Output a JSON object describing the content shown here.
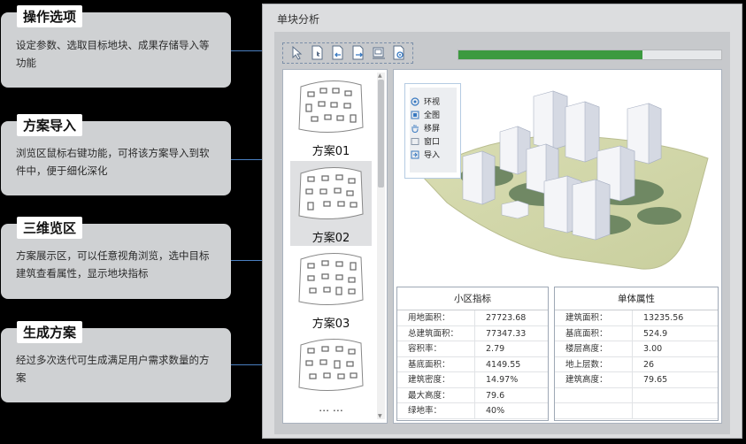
{
  "annotations": [
    {
      "title": "操作选项",
      "desc": "设定参数、选取目标地块、成果存储导入等功能"
    },
    {
      "title": "方案导入",
      "desc": "浏览区鼠标右键功能，可将该方案导入到软件中，便于细化深化"
    },
    {
      "title": "三维览区",
      "desc": "方案展示区，可以任意视角浏览，选中目标建筑查看属性，显示地块指标"
    },
    {
      "title": "生成方案",
      "desc": "经过多次迭代可生成满足用户需求数量的方案"
    }
  ],
  "app": {
    "title": "单块分析"
  },
  "toolbar": {
    "icons": [
      "cursor-icon",
      "select-block-icon",
      "import-icon",
      "export-icon",
      "save-icon",
      "settings-icon"
    ]
  },
  "progress": {
    "percent": 70
  },
  "schemes": [
    {
      "label": "方案01",
      "selected": false
    },
    {
      "label": "方案02",
      "selected": true
    },
    {
      "label": "方案03",
      "selected": false
    },
    {
      "label": "",
      "selected": false
    }
  ],
  "schemes_more": "… …",
  "context_menu": [
    {
      "icon": "orbit-icon",
      "label": "环视"
    },
    {
      "icon": "fit-all-icon",
      "label": "全图"
    },
    {
      "icon": "pan-hand-icon",
      "label": "移屏"
    },
    {
      "icon": "window-icon",
      "label": "窗口"
    },
    {
      "icon": "import-icon",
      "label": "导入"
    }
  ],
  "district_table": {
    "title": "小区指标",
    "rows": [
      {
        "key": "用地面积：",
        "value": "27723.68"
      },
      {
        "key": "总建筑面积：",
        "value": "77347.33"
      },
      {
        "key": "容积率：",
        "value": "2.79"
      },
      {
        "key": "基底面积：",
        "value": "4149.55"
      },
      {
        "key": "建筑密度：",
        "value": "14.97%"
      },
      {
        "key": "最大高度：",
        "value": "79.6"
      },
      {
        "key": "绿地率：",
        "value": "40%"
      }
    ]
  },
  "building_table": {
    "title": "单体属性",
    "rows": [
      {
        "key": "建筑面积：",
        "value": "13235.56"
      },
      {
        "key": "基底面积：",
        "value": "524.9"
      },
      {
        "key": "楼层高度：",
        "value": "3.00"
      },
      {
        "key": "地上层数：",
        "value": "26"
      },
      {
        "key": "建筑高度：",
        "value": "79.65"
      },
      {
        "key": "",
        "value": ""
      },
      {
        "key": "",
        "value": ""
      }
    ]
  },
  "colors": {
    "accent": "#3778c0",
    "progress": "#3c9a3f",
    "card": "#cfd1d3"
  }
}
